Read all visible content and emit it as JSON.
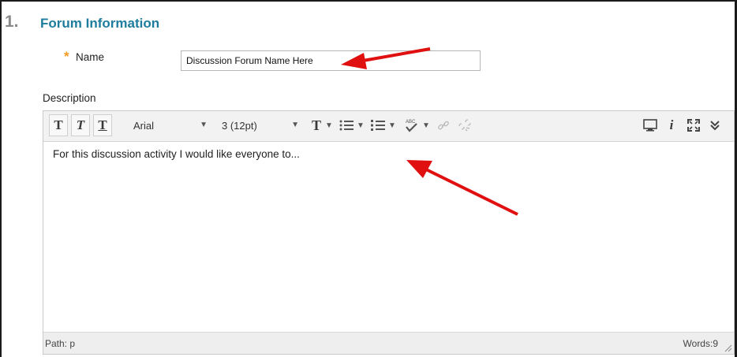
{
  "section": {
    "number": "1.",
    "title": "Forum Information"
  },
  "name_field": {
    "required_marker": "*",
    "label": "Name",
    "value": "Discussion Forum Name Here"
  },
  "description": {
    "label": "Description",
    "toolbar": {
      "bold": "T",
      "italic": "T",
      "underline": "T",
      "font_family": "Arial",
      "font_size": "3 (12pt)",
      "text_color": "T"
    },
    "content": "For this discussion activity I would like everyone to...",
    "status": {
      "path": "Path: p",
      "words": "Words:9"
    }
  },
  "colors": {
    "accent": "#1e7d9e",
    "required": "#f29b1d",
    "annotation": "#e01010"
  },
  "icons": [
    "bold-icon",
    "italic-icon",
    "underline-icon",
    "text-color-icon",
    "bullet-list-icon",
    "numbered-list-icon",
    "spellcheck-icon",
    "link-icon",
    "unlink-icon",
    "preview-icon",
    "info-icon",
    "fullscreen-icon",
    "expand-icon"
  ]
}
